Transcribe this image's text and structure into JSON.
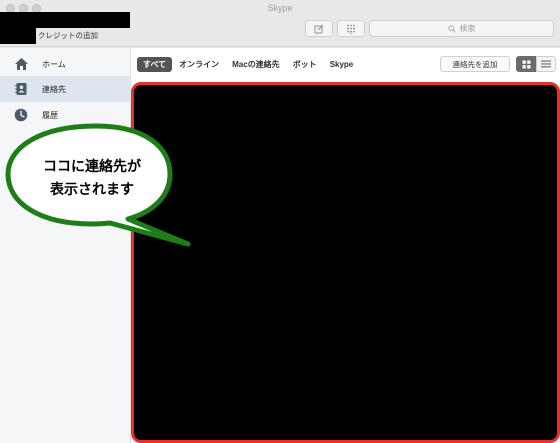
{
  "window": {
    "title": "Skype"
  },
  "profile": {
    "credit_label": "クレジットの追加"
  },
  "toolbar": {
    "search_placeholder": "検索",
    "compose_icon": "compose-icon",
    "dialpad_icon": "dialpad-icon"
  },
  "sidebar": {
    "items": [
      {
        "label": "ホーム",
        "icon": "home-icon",
        "active": false
      },
      {
        "label": "連絡先",
        "icon": "contacts-icon",
        "active": true
      },
      {
        "label": "履歴",
        "icon": "clock-icon",
        "active": false
      }
    ]
  },
  "main": {
    "filters": [
      {
        "label": "すべて",
        "selected": true
      },
      {
        "label": "オンライン",
        "selected": false
      },
      {
        "label": "Macの連絡先",
        "selected": false
      },
      {
        "label": "ボット",
        "selected": false
      },
      {
        "label": "Skype",
        "selected": false
      }
    ],
    "add_contact_label": "連絡先を追加",
    "view_modes": [
      "grid-view-icon",
      "list-view-icon"
    ]
  },
  "annotation": {
    "line1": "ココに連絡先が",
    "line2": "表示されます"
  },
  "colors": {
    "highlight_border": "#e4322b",
    "bubble_border": "#1e7d16",
    "active_nav": "#dde6ef"
  }
}
